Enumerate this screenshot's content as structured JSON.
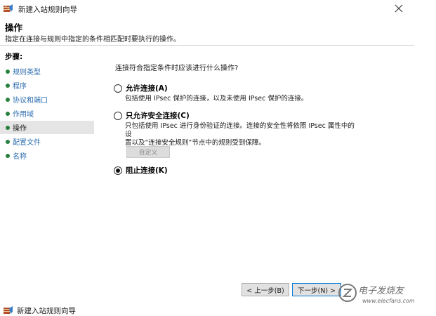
{
  "window": {
    "title": "新建入站规则向导",
    "icon": "firewall-icon"
  },
  "header": {
    "title": "操作",
    "description": "指定在连接与规则中指定的条件相匹配时要执行的操作。"
  },
  "sidebar": {
    "steps_label": "步骤:",
    "items": [
      {
        "label": "规则类型",
        "active": false
      },
      {
        "label": "程序",
        "active": false
      },
      {
        "label": "协议和端口",
        "active": false
      },
      {
        "label": "作用域",
        "active": false
      },
      {
        "label": "操作",
        "active": true
      },
      {
        "label": "配置文件",
        "active": false
      },
      {
        "label": "名称",
        "active": false
      }
    ]
  },
  "content": {
    "question": "连接符合指定条件时应该进行什么操作?",
    "options": [
      {
        "label": "允许连接(A)",
        "description": "包括使用 IPsec 保护的连接，以及未使用 IPsec 保护的连接。",
        "checked": false
      },
      {
        "label": "只允许安全连接(C)",
        "description_line1": "只包括使用 IPsec 进行身份验证的连接。连接的安全性将依照 IPsec 属性中的设",
        "description_line2": "置以及“连接安全规则”节点中的规则受到保障。",
        "checked": false
      },
      {
        "label": "阻止连接(K)",
        "checked": true
      }
    ],
    "customize_label": "自定义"
  },
  "buttons": {
    "back": "< 上一步(B)",
    "next": "下一步(N) >"
  },
  "watermark": {
    "text": "电子发烧友",
    "url": "www.elecfans.com"
  },
  "second_window": {
    "title": "新建入站规则向导"
  }
}
